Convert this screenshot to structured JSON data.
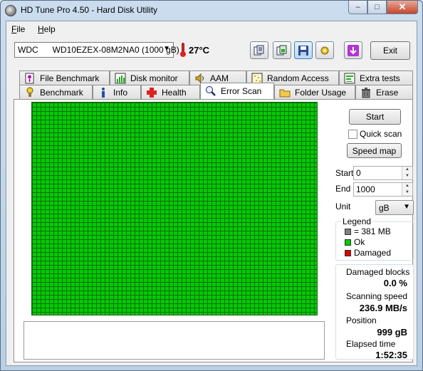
{
  "window": {
    "title": "HD Tune Pro 4.50 - Hard Disk Utility",
    "minimize_label": "–",
    "maximize_label": "□",
    "close_label": "✕"
  },
  "menu": {
    "file_underlined": "F",
    "file_rest": "ile",
    "help_underlined": "H",
    "help_rest": "elp"
  },
  "toolbar": {
    "drive": "WDC      WD10EZEX-08M2NA0 (1000 gB)",
    "temperature": "27",
    "temperature_unit": "°C",
    "exit_label": "Exit",
    "icons": [
      "copy-text-icon",
      "copy-screenshot-icon",
      "save-icon",
      "options-icon",
      "download-icon"
    ]
  },
  "tabs": {
    "row1": [
      "File Benchmark",
      "Disk monitor",
      "AAM",
      "Random Access",
      "Extra tests"
    ],
    "row2": [
      "Benchmark",
      "Info",
      "Health",
      "Error Scan",
      "Folder Usage",
      "Erase"
    ],
    "selected": "Error Scan"
  },
  "scan": {
    "start_button": "Start",
    "quick_scan_label": "Quick scan",
    "quick_scan_checked": false,
    "speed_map_button": "Speed map",
    "start_label": "Start",
    "start_value": "0",
    "end_label": "End",
    "end_value": "1000",
    "unit_label": "Unit",
    "unit_value": "gB"
  },
  "legend": {
    "title": "Legend",
    "block_size": "= 381 MB",
    "ok": "Ok",
    "damaged": "Damaged",
    "colors": {
      "block": "#808080",
      "ok": "#00cc00",
      "damaged": "#dd0000"
    }
  },
  "stats": {
    "damaged_blocks_label": "Damaged blocks",
    "damaged_blocks_value": "0.0 %",
    "scanning_speed_label": "Scanning speed",
    "scanning_speed_value": "236.9 MB/s",
    "position_label": "Position",
    "position_value": "999 gB",
    "elapsed_label": "Elapsed time",
    "elapsed_value": "1:52:35"
  },
  "grid": {
    "status": "all-ok",
    "color": "#00cc00"
  }
}
